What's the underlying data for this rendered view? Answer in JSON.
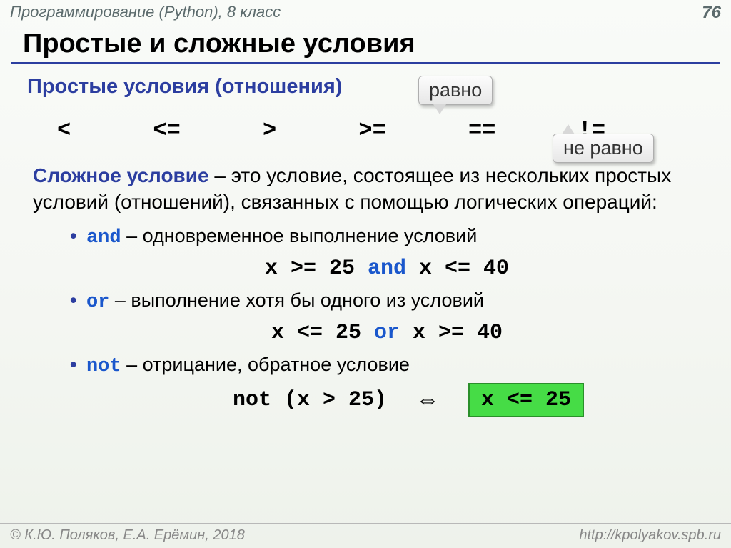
{
  "header": {
    "course": "Программирование (Python), 8 класс",
    "page": "76"
  },
  "title": "Простые и сложные условия",
  "subhead": "Простые условия (отношения)",
  "callouts": {
    "equal": "равно",
    "notequal": "не равно"
  },
  "operators": [
    "<",
    "<=",
    ">",
    ">=",
    "==",
    "!="
  ],
  "definition": {
    "term": "Сложное условие",
    "rest": " – это условие, состоящее из нескольких простых условий (отношений), связанных с помощью логических операций:"
  },
  "bullets": {
    "and": {
      "kw": "and",
      "text": " – одновременное выполнение условий",
      "code_pre": "x >= 25 ",
      "code_kw": "and",
      "code_post": " x <= 40"
    },
    "or": {
      "kw": "or",
      "text": " – выполнение хотя бы одного из условий",
      "code_pre": "x <= 25 ",
      "code_kw": "or",
      "code_post": " x >= 40"
    },
    "not": {
      "kw": "not",
      "text": " – отрицание, обратное условие",
      "code_kw": "not",
      "code_post": " (x > 25)",
      "equiv": "x <= 25"
    }
  },
  "arrow": "⇔",
  "footer": {
    "left": "© К.Ю. Поляков, Е.А. Ерёмин, 2018",
    "right": "http://kpolyakov.spb.ru"
  }
}
